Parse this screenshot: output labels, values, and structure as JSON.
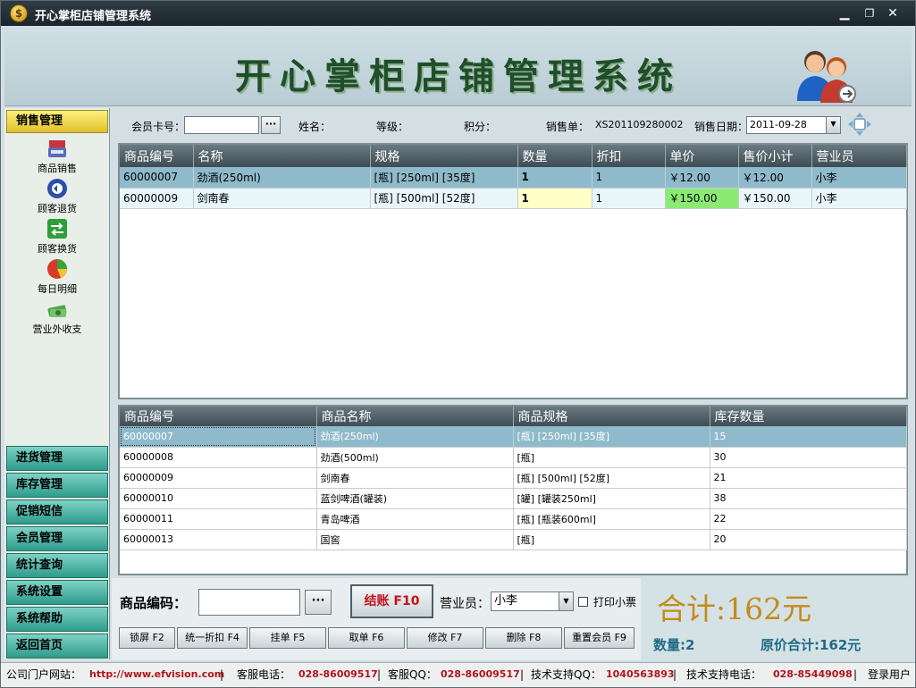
{
  "window": {
    "title": "开心掌柜店铺管理系统",
    "app_icon_glyph": "$",
    "minimize": "▁",
    "restore": "❐",
    "close": "✕"
  },
  "banner": {
    "title": "开心掌柜店铺管理系统",
    "icon": "users-icon"
  },
  "sidebar": {
    "header": "销售管理",
    "items": [
      {
        "label": "商品销售",
        "icon": "cash-register-icon"
      },
      {
        "label": "顾客退货",
        "icon": "return-icon"
      },
      {
        "label": "顾客换货",
        "icon": "exchange-icon"
      },
      {
        "label": "每日明细",
        "icon": "pie-chart-icon"
      },
      {
        "label": "营业外收支",
        "icon": "money-icon"
      }
    ],
    "nav": [
      "进货管理",
      "库存管理",
      "促销短信",
      "会员管理",
      "统计查询",
      "系统设置",
      "系统帮助",
      "返回首页"
    ]
  },
  "topbar": {
    "member_card_label": "会员卡号：",
    "member_card_value": "",
    "browse_button": "···",
    "name_label": "姓名：",
    "level_label": "等级：",
    "points_label": "积分：",
    "order_label": "销售单：",
    "order_value": "XS201109280002",
    "date_label": "销售日期：",
    "date_value": "2011-09-28"
  },
  "sales_grid": {
    "columns": [
      "商品编号",
      "名称",
      "规格",
      "数量",
      "折扣",
      "单价",
      "售价小计",
      "营业员"
    ],
    "rows": [
      [
        "60000007",
        "劲酒(250ml)",
        "[瓶] [250ml] [35度]",
        "1",
        "1",
        "￥12.00",
        "￥12.00",
        "小李"
      ],
      [
        "60000009",
        "剑南春",
        "[瓶] [500ml] [52度]",
        "1",
        "1",
        "￥150.00",
        "￥150.00",
        "小李"
      ]
    ]
  },
  "stock_grid": {
    "columns": [
      "商品编号",
      "商品名称",
      "商品规格",
      "库存数量"
    ],
    "rows": [
      [
        "60000007",
        "劲酒(250ml)",
        "[瓶] [250ml] [35度]",
        "15"
      ],
      [
        "60000008",
        "劲酒(500ml)",
        "[瓶]",
        "30"
      ],
      [
        "60000009",
        "剑南春",
        "[瓶] [500ml] [52度]",
        "21"
      ],
      [
        "60000010",
        "蓝剑啤酒(罐装)",
        "[罐] [罐装250ml]",
        "38"
      ],
      [
        "60000011",
        "青岛啤酒",
        "[瓶] [瓶装600ml]",
        "22"
      ],
      [
        "60000013",
        "国窖",
        "[瓶]",
        "20"
      ]
    ]
  },
  "bottom": {
    "product_code_label": "商品编码：",
    "product_code_value": "",
    "browse_button": "···",
    "checkout_button": "结账 F10",
    "salesperson_label": "营业员：",
    "salesperson_value": "小李",
    "print_receipt_label": "打印小票",
    "print_receipt_checked": false,
    "function_buttons": [
      "锁屏 F2",
      "统一折扣 F4",
      "挂单 F5",
      "取单 F6",
      "修改 F7",
      "删除 F8",
      "重置会员 F9"
    ],
    "total": "合计:162元",
    "quantity": "数量:2",
    "original_total": "原价合计:162元"
  },
  "statusbar": {
    "website_label": "公司门户网站：",
    "website": "http://www.efvision.com",
    "phone_label": "客服电话：",
    "phone": "028-86009517",
    "qq_label": "客服QQ：",
    "qq": "028-86009517",
    "tech_qq_label": "技术支持QQ：",
    "tech_qq": "1040563893",
    "tech_phone_label": "技术支持电话：",
    "tech_phone": "028-85449098",
    "user": "登录用户"
  },
  "colors": {
    "title_bar": "#1f2a30",
    "nav_button": "#2e9c8b",
    "section_header": "#e0c12b",
    "checkout_text": "#c4121c",
    "total_text": "#c68a1a",
    "summary_text": "#1f6a86",
    "selected_row": "#8fbacb",
    "edit_cell": "#ffffc8",
    "price_highlight": "#8bea72"
  }
}
